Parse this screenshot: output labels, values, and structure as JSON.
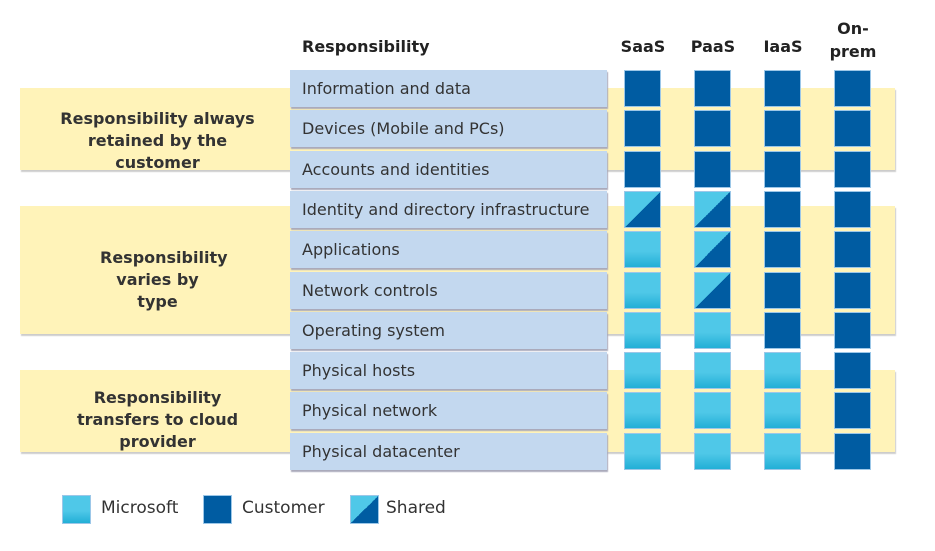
{
  "headers": {
    "responsibility": "Responsibility",
    "columns": [
      "SaaS",
      "PaaS",
      "IaaS",
      "On-\nprem"
    ]
  },
  "groups": [
    {
      "title": "Responsibility always retained by the customer"
    },
    {
      "title": "Responsibility varies by type"
    },
    {
      "title": "Responsibility transfers to cloud provider"
    }
  ],
  "rows": [
    {
      "label": "Information and data",
      "cells": [
        "customer",
        "customer",
        "customer",
        "customer"
      ]
    },
    {
      "label": "Devices (Mobile and PCs)",
      "cells": [
        "customer",
        "customer",
        "customer",
        "customer"
      ]
    },
    {
      "label": "Accounts and identities",
      "cells": [
        "customer",
        "customer",
        "customer",
        "customer"
      ]
    },
    {
      "label": "Identity and directory infrastructure",
      "cells": [
        "shared",
        "shared",
        "customer",
        "customer"
      ]
    },
    {
      "label": "Applications",
      "cells": [
        "microsoft",
        "shared",
        "customer",
        "customer"
      ]
    },
    {
      "label": "Network controls",
      "cells": [
        "microsoft",
        "shared",
        "customer",
        "customer"
      ]
    },
    {
      "label": "Operating system",
      "cells": [
        "microsoft",
        "microsoft",
        "customer",
        "customer"
      ]
    },
    {
      "label": "Physical hosts",
      "cells": [
        "microsoft",
        "microsoft",
        "microsoft",
        "customer"
      ]
    },
    {
      "label": "Physical network",
      "cells": [
        "microsoft",
        "microsoft",
        "microsoft",
        "customer"
      ]
    },
    {
      "label": "Physical datacenter",
      "cells": [
        "microsoft",
        "microsoft",
        "microsoft",
        "customer"
      ]
    }
  ],
  "legend": [
    {
      "key": "microsoft",
      "label": "Microsoft"
    },
    {
      "key": "customer",
      "label": "Customer"
    },
    {
      "key": "shared",
      "label": "Shared"
    }
  ],
  "colors": {
    "customer": "#005ca2",
    "microsoft": "#4fc8e8",
    "group_band": "#fff3b9",
    "row_label": "#c3d8ef"
  }
}
